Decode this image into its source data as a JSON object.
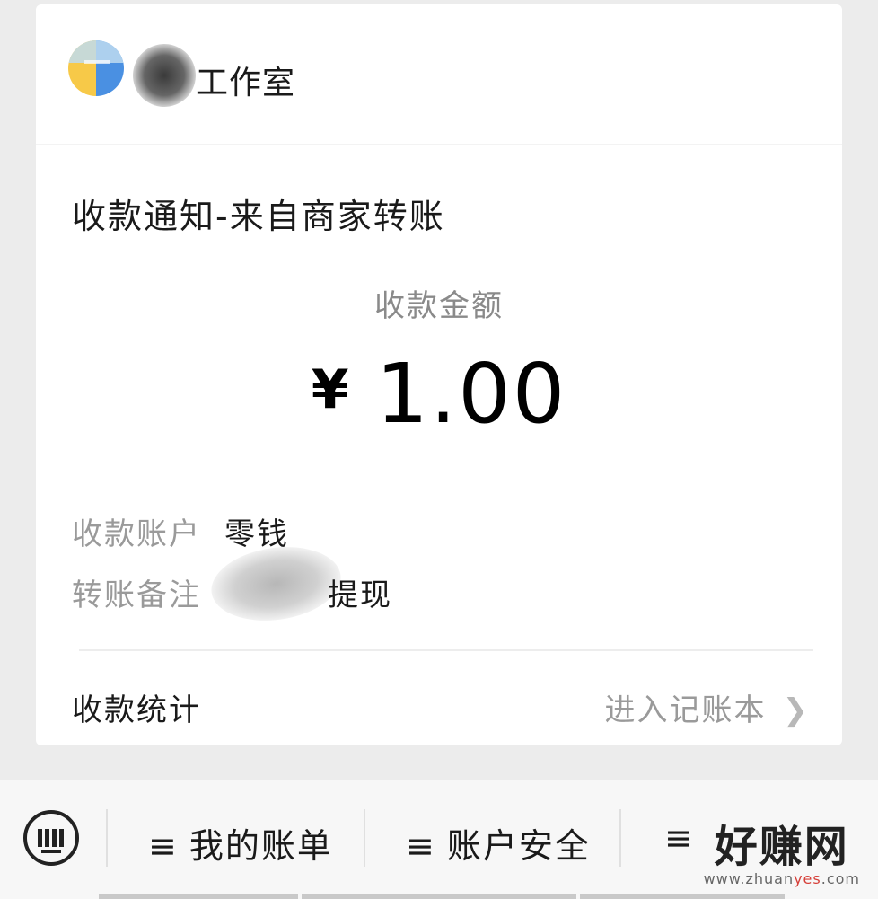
{
  "header": {
    "merchant_name_visible": "工作室"
  },
  "notice": {
    "title": "收款通知-来自商家转账",
    "amount_label": "收款金额",
    "currency_symbol": "¥",
    "amount": "1.00",
    "account_label": "收款账户",
    "account_value": "零钱",
    "remark_label": "转账备注",
    "remark_value_visible": "提现",
    "stats_label": "收款统计",
    "ledger_link": "进入记账本"
  },
  "bottom_menu": {
    "items": [
      {
        "label": "我的账单"
      },
      {
        "label": "账户安全"
      }
    ]
  },
  "watermark": {
    "main": "好赚网",
    "sub_prefix": "www.zhuan",
    "sub_highlight": "yes",
    "sub_suffix": ".com"
  },
  "icons": {
    "keyboard": "keyboard-icon",
    "chevron": "chevron-right-icon",
    "menu": "menu-lines-icon"
  }
}
